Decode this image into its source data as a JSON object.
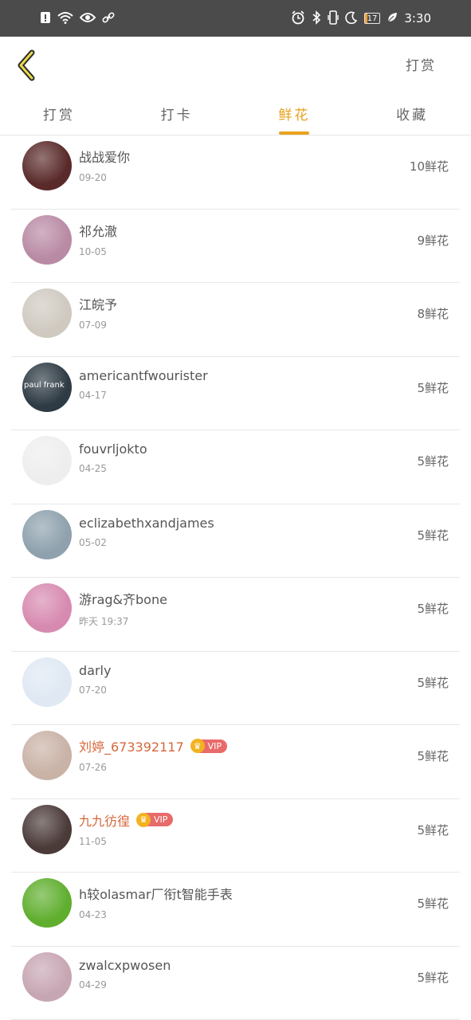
{
  "status_bar": {
    "time": "3:30",
    "battery": "17",
    "icons_left": [
      "alert-icon",
      "wifi-icon",
      "eye-icon",
      "link-icon"
    ],
    "icons_right": [
      "alarm-icon",
      "bluetooth-icon",
      "vibrate-icon",
      "moon-icon",
      "battery-icon",
      "leaf-icon"
    ]
  },
  "header": {
    "action": "打赏"
  },
  "tabs": [
    {
      "label": "打赏"
    },
    {
      "label": "打卡"
    },
    {
      "label": "鲜花"
    },
    {
      "label": "收藏"
    }
  ],
  "active_tab": 2,
  "list": [
    {
      "name": "战战爱你",
      "date": "09-20",
      "count": "10鲜花",
      "vip": false,
      "avatar_color": "#5a2a2a"
    },
    {
      "name": "祁允澈",
      "date": "10-05",
      "count": "9鲜花",
      "vip": false,
      "avatar_color": "#b98aa4"
    },
    {
      "name": "江皖予",
      "date": "07-09",
      "count": "8鲜花",
      "vip": false,
      "avatar_color": "#cfc9c0"
    },
    {
      "name": "americantfwourister",
      "date": "04-17",
      "count": "5鲜花",
      "vip": false,
      "avatar_color": "#2e3b44",
      "avatar_text": "paul frank"
    },
    {
      "name": "fouvrljokto",
      "date": "04-25",
      "count": "5鲜花",
      "vip": false,
      "avatar_color": "#eeeeee"
    },
    {
      "name": "eclizabethxandjames",
      "date": "05-02",
      "count": "5鲜花",
      "vip": false,
      "avatar_color": "#8ea1ad"
    },
    {
      "name": "游rag&齐bone",
      "date": "昨天 19:37",
      "count": "5鲜花",
      "vip": false,
      "avatar_color": "#d78ab0"
    },
    {
      "name": "darly",
      "date": "07-20",
      "count": "5鲜花",
      "vip": false,
      "avatar_color": "#dfe8f3"
    },
    {
      "name": "刘婷_673392117",
      "date": "07-26",
      "count": "5鲜花",
      "vip": true,
      "vip_label": "VIP",
      "avatar_color": "#c9b2a6"
    },
    {
      "name": "九九彷徨",
      "date": "11-05",
      "count": "5鲜花",
      "vip": true,
      "vip_label": "VIP",
      "avatar_color": "#4a3a38"
    },
    {
      "name": "h较olasmar厂衔t智能手表",
      "date": "04-23",
      "count": "5鲜花",
      "vip": false,
      "avatar_color": "#5fae2e"
    },
    {
      "name": "zwalcxpwosen",
      "date": "04-29",
      "count": "5鲜花",
      "vip": false,
      "avatar_color": "#c7a6b3"
    }
  ]
}
